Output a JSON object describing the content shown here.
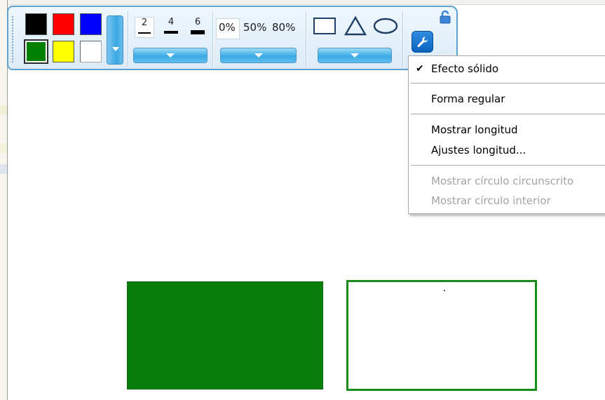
{
  "toolbar": {
    "colors": [
      {
        "name": "black",
        "hex": "#000000",
        "selected": false
      },
      {
        "name": "red",
        "hex": "#ff0000",
        "selected": false
      },
      {
        "name": "blue",
        "hex": "#0000ff",
        "selected": false
      },
      {
        "name": "green",
        "hex": "#008000",
        "selected": true
      },
      {
        "name": "yellow",
        "hex": "#ffff00",
        "selected": false
      },
      {
        "name": "white",
        "hex": "#ffffff",
        "selected": false
      }
    ],
    "line_widths": [
      "2",
      "4",
      "6"
    ],
    "transparency": [
      "0%",
      "50%",
      "80%"
    ],
    "shapes": [
      "rectangle-icon",
      "triangle-icon",
      "ellipse-icon"
    ],
    "settings_icon": "wrench-icon",
    "lock_icon": "lock-icon"
  },
  "menu": {
    "items": [
      {
        "label": "Efecto sólido",
        "checked": true,
        "enabled": true
      },
      {
        "label": "Forma regular",
        "checked": false,
        "enabled": true
      },
      {
        "label": "Mostrar longitud",
        "checked": false,
        "enabled": true
      },
      {
        "label": "Ajustes longitud...",
        "checked": false,
        "enabled": true
      },
      {
        "label": "Mostrar círculo circunscrito",
        "checked": false,
        "enabled": false
      },
      {
        "label": "Mostrar círculo interior",
        "checked": false,
        "enabled": false
      }
    ],
    "check_glyph": "✔"
  },
  "canvas": {
    "fill_color": "#0a7e0a",
    "outline_color": "#1a8c1a"
  }
}
